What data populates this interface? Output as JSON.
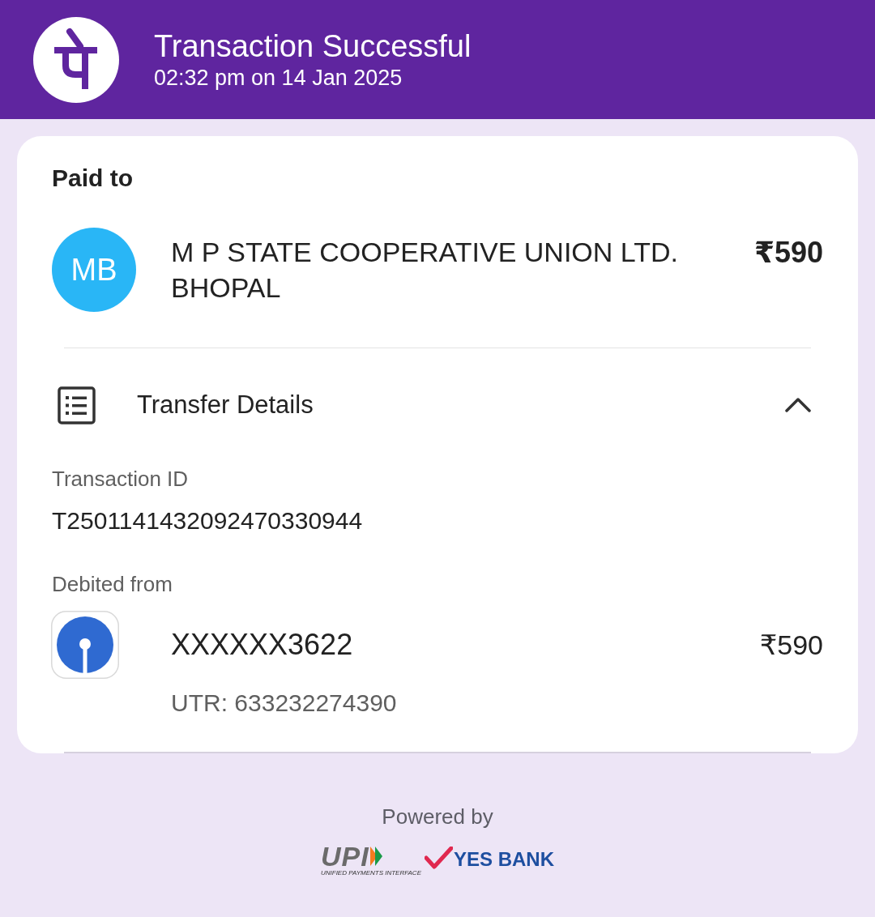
{
  "header": {
    "title": "Transaction Successful",
    "subtitle": "02:32 pm on 14 Jan 2025"
  },
  "payee": {
    "heading": "Paid to",
    "initials": "MB",
    "name": "M P STATE COOPERATIVE UNION LTD. BHOPAL",
    "amount": "₹590"
  },
  "transfer_details": {
    "title": "Transfer Details",
    "expanded": true,
    "fields": [
      {
        "label": "Transaction ID",
        "value": "T2501141432092470330944"
      }
    ],
    "debited_from": {
      "label": "Debited from",
      "account": "XXXXXX3622",
      "amount": "₹590",
      "utr": "UTR: 633232274390"
    }
  },
  "footer": {
    "powered_by": "Powered by",
    "upi_logo": "UPI",
    "upi_tagline": "UNIFIED PAYMENTS INTERFACE",
    "bank_logo": "YES BANK"
  }
}
